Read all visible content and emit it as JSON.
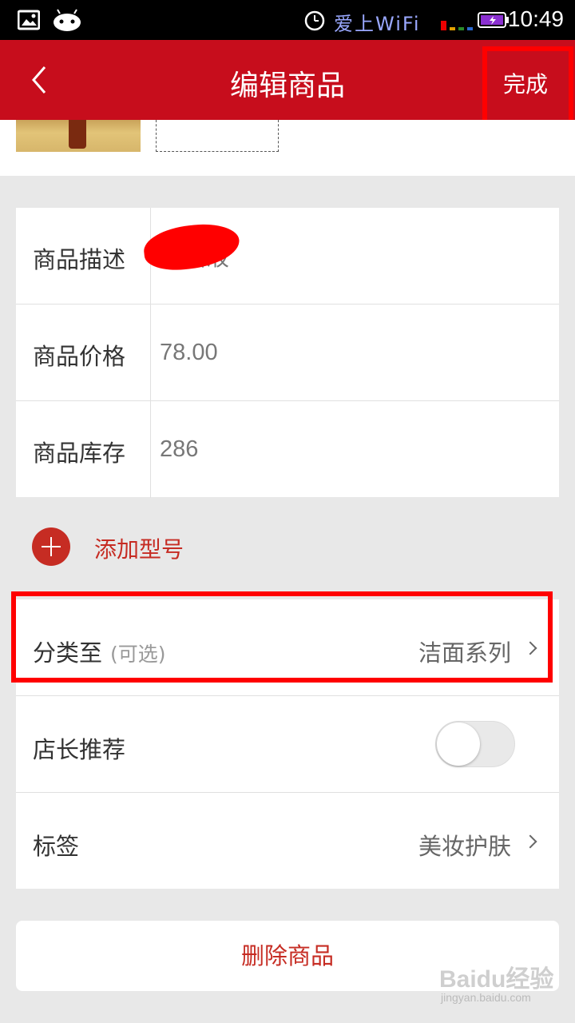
{
  "status_bar": {
    "time": "10:49",
    "wifi_label": "爱上WiFi",
    "icons": [
      "image-icon",
      "android-icon",
      "alarm-icon",
      "signal-icon",
      "battery-icon"
    ]
  },
  "navbar": {
    "title": "编辑商品",
    "done_label": "完成",
    "background_color": "#c70d1c"
  },
  "form": {
    "description": {
      "label": "商品描述",
      "value": "洁面液"
    },
    "price": {
      "label": "商品价格",
      "value": "78.00"
    },
    "stock": {
      "label": "商品库存",
      "value": "286"
    }
  },
  "add_model": {
    "label": "添加型号"
  },
  "options": {
    "category": {
      "label": "分类至",
      "sub_label": "(可选)",
      "value": "洁面系列"
    },
    "recommend": {
      "label": "店长推荐",
      "enabled": false
    },
    "tag": {
      "label": "标签",
      "value": "美妆护肤"
    }
  },
  "delete_button": {
    "label": "删除商品"
  },
  "watermark": {
    "main": "Baidu经验",
    "sub": "jingyan.baidu.com"
  },
  "accent_color": "#c62c23",
  "highlight_color": "#ff0000"
}
